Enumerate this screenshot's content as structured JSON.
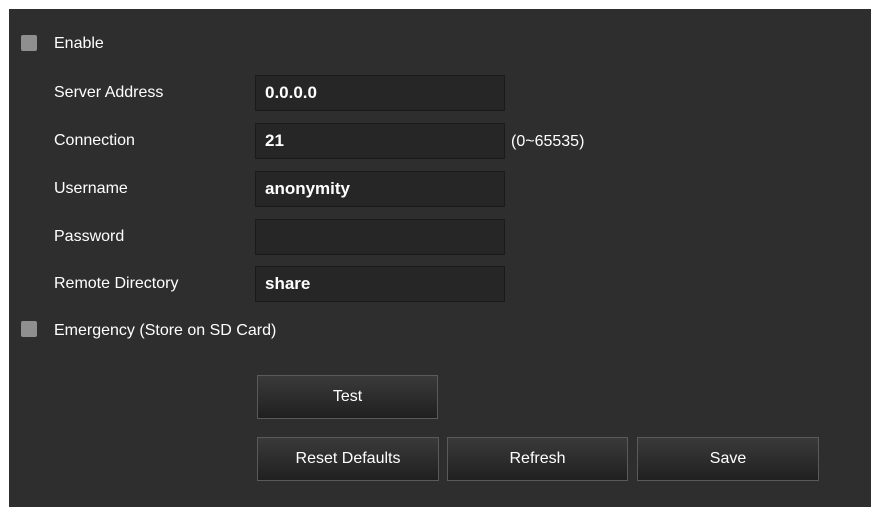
{
  "enable": {
    "label": "Enable",
    "checked": false
  },
  "form": {
    "server_address": {
      "label": "Server Address",
      "value": "0.0.0.0"
    },
    "connection": {
      "label": "Connection",
      "value": "21",
      "hint": "(0~65535)"
    },
    "username": {
      "label": "Username",
      "value": "anonymity"
    },
    "password": {
      "label": "Password",
      "value": ""
    },
    "remote_directory": {
      "label": "Remote Directory",
      "value": "share"
    }
  },
  "emergency": {
    "label": "Emergency (Store on SD Card)",
    "checked": false
  },
  "buttons": {
    "test": "Test",
    "reset_defaults": "Reset Defaults",
    "refresh": "Refresh",
    "save": "Save"
  },
  "colors": {
    "panel_background": "#2e2e2e",
    "field_background": "#262626",
    "checkbox": "#8f8f8f",
    "text": "#ffffff"
  }
}
